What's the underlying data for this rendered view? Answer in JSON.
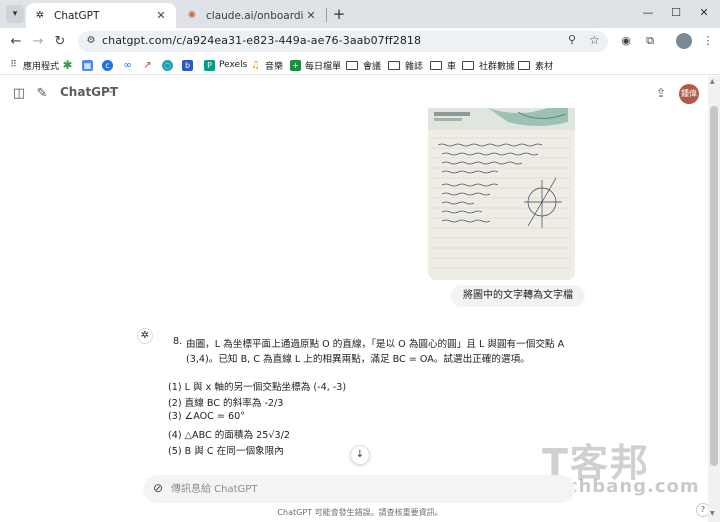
{
  "browser": {
    "tabs": [
      {
        "title": "ChatGPT",
        "active": true,
        "favicon": "openai-icon"
      },
      {
        "title": "claude.ai/onboarding",
        "active": false,
        "favicon": "claude-icon"
      }
    ],
    "url": "chatgpt.com/c/a924ea31-e823-449a-ae76-3aab07ff2818",
    "bookmarks": [
      {
        "label": "應用程式",
        "icon": "apps-grid-icon"
      },
      {
        "label": "",
        "icon": "star-green-icon"
      },
      {
        "label": "",
        "icon": "calendar-icon"
      },
      {
        "label": "",
        "icon": "c-blue-icon"
      },
      {
        "label": "",
        "icon": "meta-icon"
      },
      {
        "label": "",
        "icon": "trend-icon"
      },
      {
        "label": "",
        "icon": "swirl-icon"
      },
      {
        "label": "",
        "icon": "b-blue-icon"
      },
      {
        "label": "Pexels",
        "icon": "pexels-icon"
      },
      {
        "label": "音樂",
        "icon": "music-icon"
      },
      {
        "label": "每日檔單",
        "icon": "plus-green-icon"
      },
      {
        "label": "會議",
        "icon": "folder-icon"
      },
      {
        "label": "雜誌",
        "icon": "folder-icon"
      },
      {
        "label": "車",
        "icon": "folder-icon"
      },
      {
        "label": "社群數據",
        "icon": "folder-icon"
      },
      {
        "label": "素材",
        "icon": "folder-icon"
      }
    ]
  },
  "app": {
    "brand": "ChatGPT",
    "avatar_text": "鍾偉"
  },
  "conversation": {
    "user_message": "將圖中的文字轉為文字檔",
    "answer": {
      "number": "8.",
      "question_line1": "由圖，L 為坐標平面上通過原點 O 的直線，「是以 O 為圓心的圓」且 L 與圓有一個交點 A",
      "question_line2": "(3,4)。已知 B, C 為直線 L 上的相異兩點，滿足 BC = OA。試選出正確的選項。",
      "options": [
        "(1) L 與 x 軸的另一個交點坐標為 (-4, -3)",
        "(2) 直線 BC 的斜率為 -2/3",
        "(3) ∠AOC = 60°",
        "(4) △ABC 的面積為 25√3/2",
        "(5) B 與 C 在同一個象限內"
      ]
    }
  },
  "composer": {
    "placeholder": "傳訊息給 ChatGPT"
  },
  "footer": "ChatGPT 可能會發生錯誤。請查核重要資訊。",
  "watermark": {
    "cjk": "T客邦",
    "en": "techbang.com"
  }
}
